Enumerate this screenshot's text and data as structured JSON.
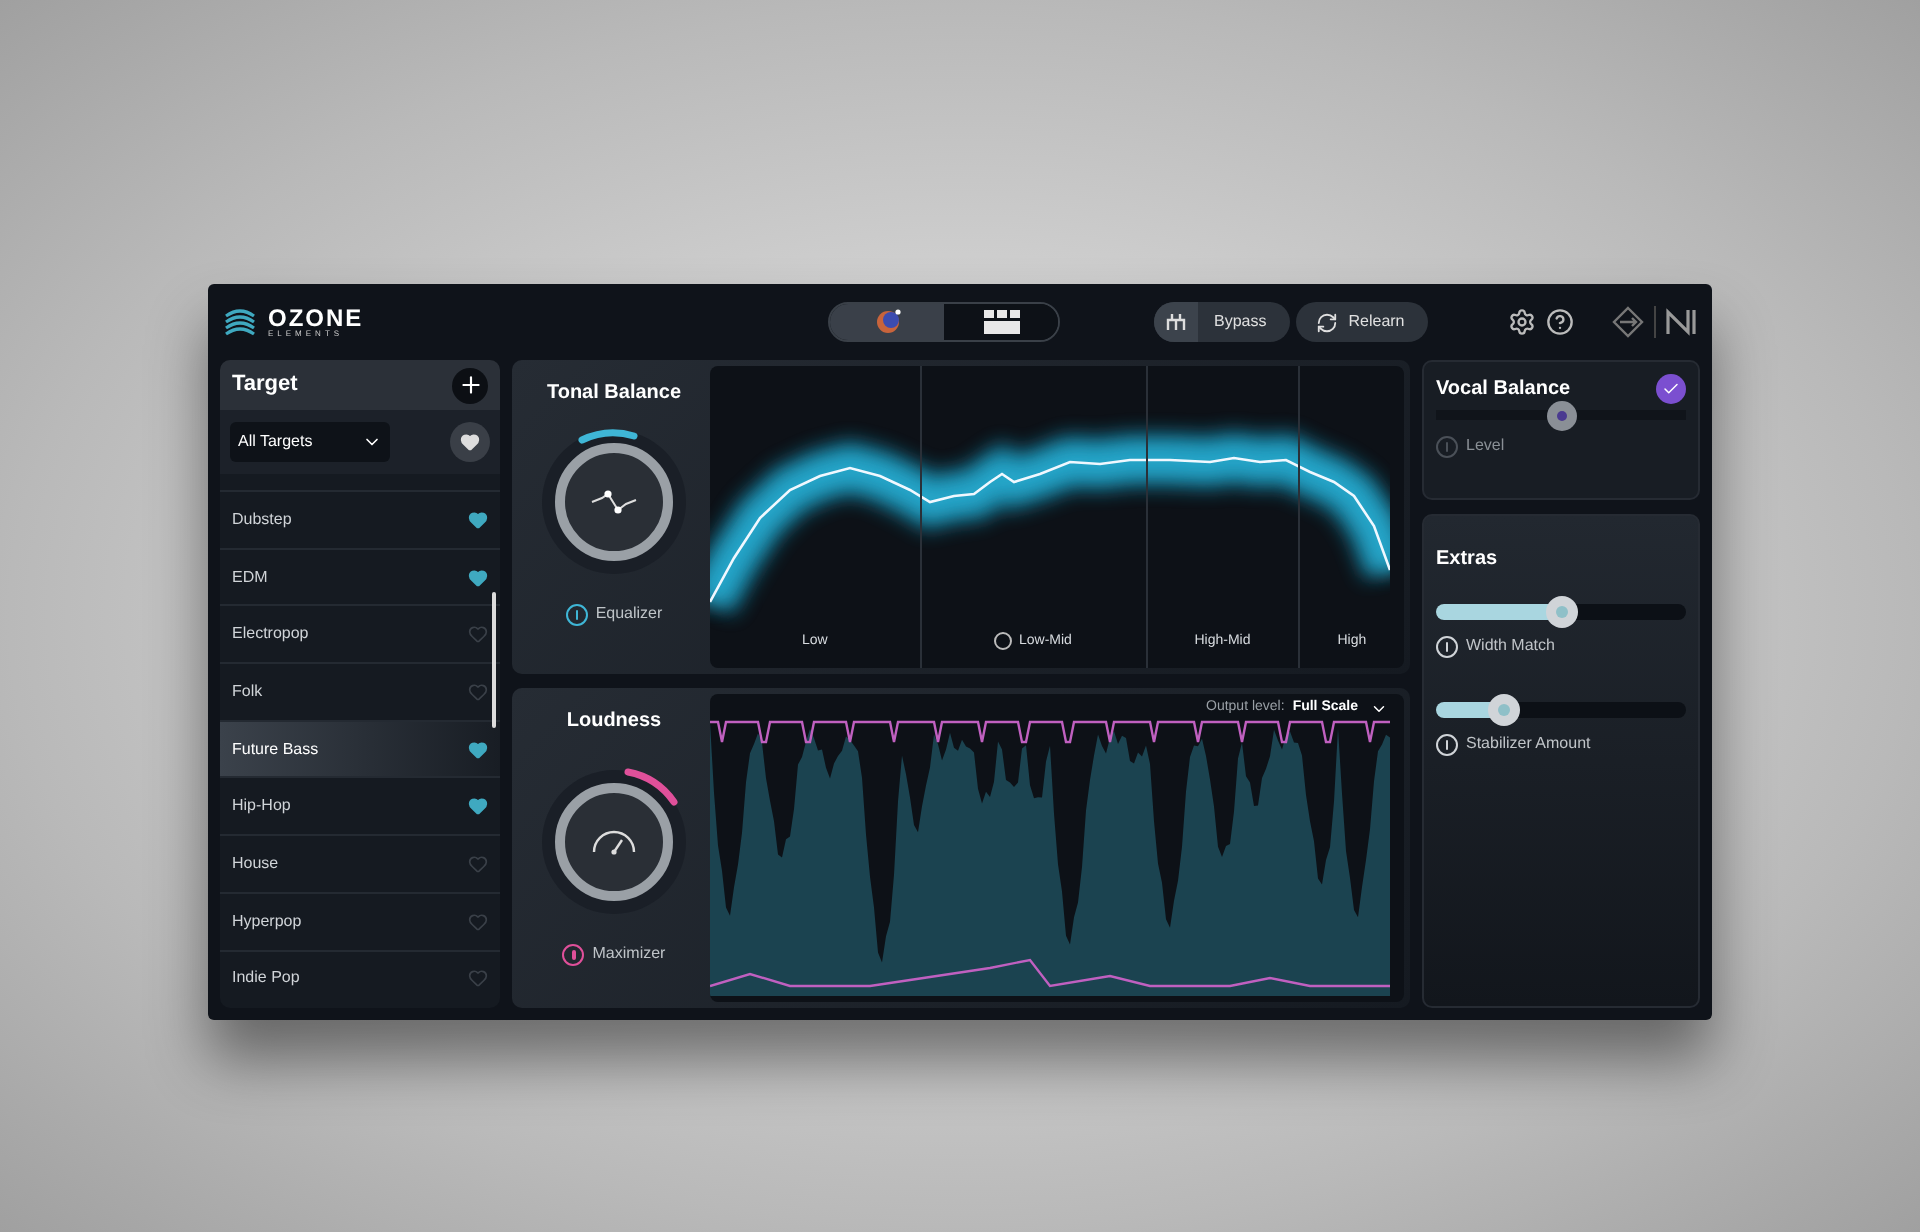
{
  "app": {
    "logo_name": "OZONE",
    "logo_subtitle": "ELEMENTS"
  },
  "view_switch": [
    {
      "selected": true
    },
    {
      "selected": false
    }
  ],
  "header_buttons": [
    {
      "kind": "bypass",
      "label": "Bypass"
    },
    {
      "kind": "relearn",
      "label": "Relearn"
    }
  ],
  "target": {
    "title": "Target",
    "filter": "All Targets",
    "items": [
      {
        "name": "Dubstep",
        "favorite": true,
        "selected": false
      },
      {
        "name": "EDM",
        "favorite": true,
        "selected": false
      },
      {
        "name": "Electropop",
        "favorite": false,
        "selected": false
      },
      {
        "name": "Folk",
        "favorite": false,
        "selected": false
      },
      {
        "name": "Future Bass",
        "favorite": true,
        "selected": true
      },
      {
        "name": "Hip-Hop",
        "favorite": true,
        "selected": false
      },
      {
        "name": "House",
        "favorite": false,
        "selected": false
      },
      {
        "name": "Hyperpop",
        "favorite": false,
        "selected": false
      },
      {
        "name": "Indie Pop",
        "favorite": false,
        "selected": false
      }
    ]
  },
  "tonal_balance": {
    "title": "Tonal Balance",
    "module": "Equalizer",
    "bands": [
      {
        "label": "Low",
        "solo": false
      },
      {
        "label": "Low-Mid",
        "solo": true
      },
      {
        "label": "High-Mid",
        "solo": false
      },
      {
        "label": "High",
        "solo": false
      }
    ]
  },
  "loudness": {
    "title": "Loudness",
    "module": "Maximizer",
    "output_label": "Output level:",
    "output_value": "Full Scale"
  },
  "vocal_balance": {
    "title": "Vocal Balance",
    "enabled": true,
    "control": "Level",
    "level": 0.5
  },
  "extras": {
    "title": "Extras",
    "sliders": [
      {
        "label": "Width Match",
        "level": 0.5
      },
      {
        "label": "Stabilizer Amount",
        "level": 0.27
      }
    ]
  }
}
